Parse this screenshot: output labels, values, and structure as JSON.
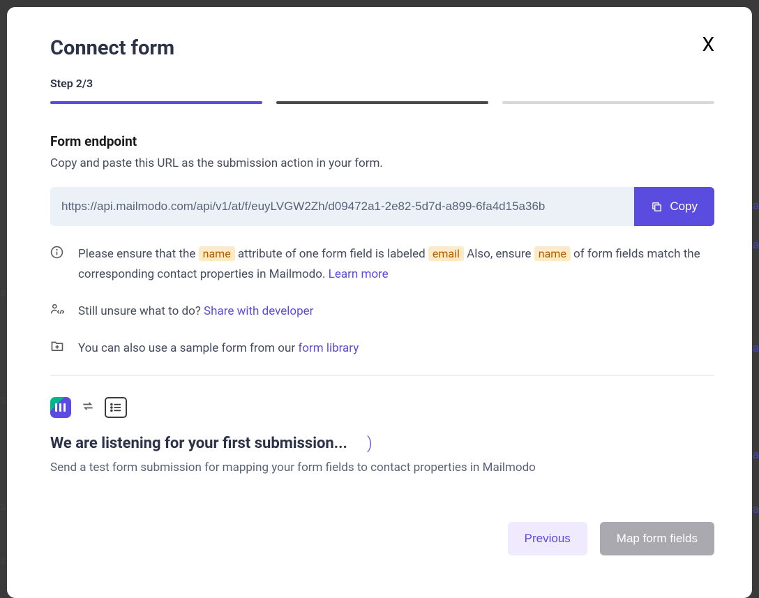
{
  "modal": {
    "title": "Connect form",
    "step_label": "Step 2/3"
  },
  "endpoint": {
    "title": "Form endpoint",
    "description": "Copy and paste this URL as the submission action in your form.",
    "url": "https://api.mailmodo.com/api/v1/at/f/euyLVGW2Zh/d09472a1-2e82-5d7d-a899-6fa4d15a36b",
    "copy_label": "Copy"
  },
  "note1": {
    "part1": "Please ensure that the ",
    "hl1": "name",
    "part2": " attribute of one form field is labeled ",
    "hl2": "email",
    "part3": " Also, ensure ",
    "hl3": "name",
    "part4": " of form fields match the corresponding contact properties in Mailmodo. ",
    "learn_more": "Learn more"
  },
  "note2": {
    "text": "Still unsure what to do?  ",
    "link": "Share with developer"
  },
  "note3": {
    "text": "You can also use a sample form from our ",
    "link": "form library"
  },
  "listening": {
    "title": "We are listening for your first submission...",
    "desc": "Send a test form submission for mapping your form fields to contact properties in Mailmodo"
  },
  "footer": {
    "previous": "Previous",
    "next": "Map form fields"
  },
  "bg": {
    "fragment_text": "eta",
    "fragment_text2": "ss"
  }
}
